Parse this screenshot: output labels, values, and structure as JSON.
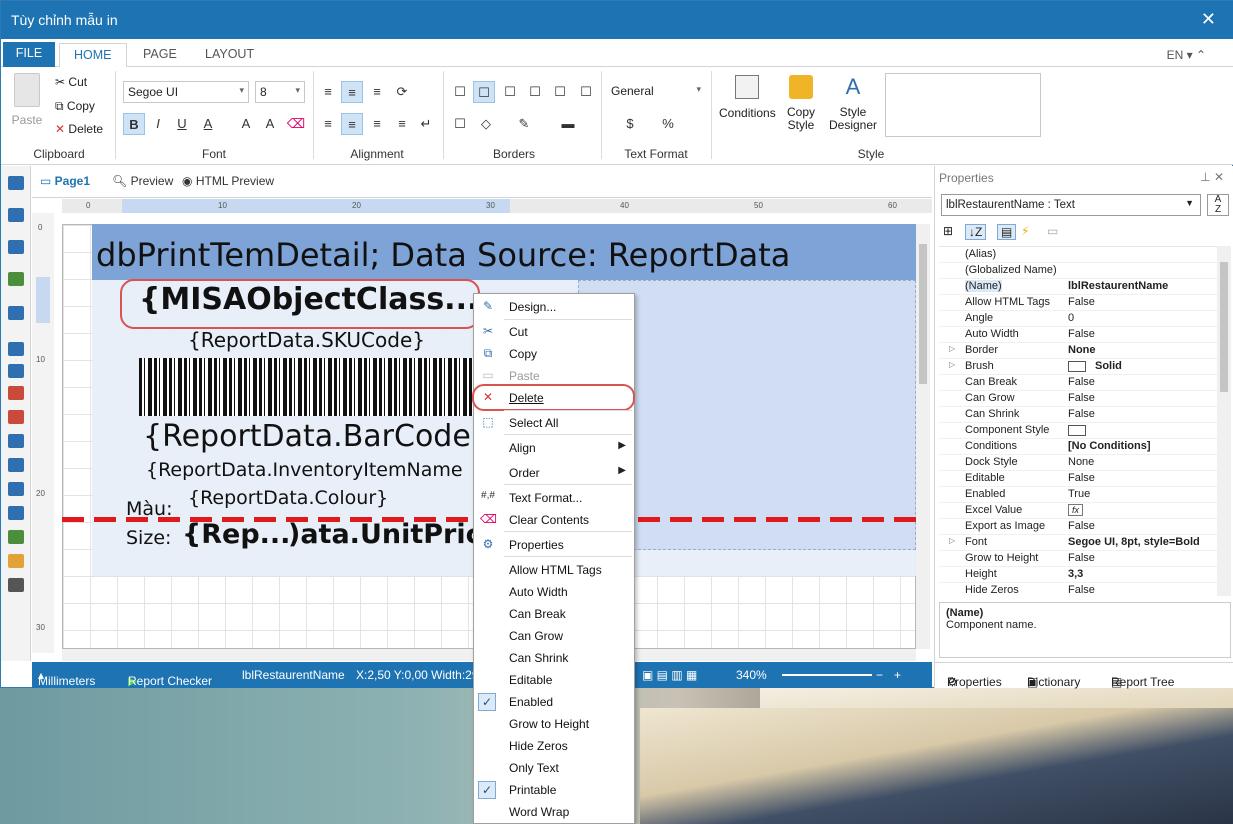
{
  "window": {
    "title": "Tùy chỉnh mẫu in",
    "close_icon": "close-icon"
  },
  "ribbon_tabs": {
    "file": "FILE",
    "home": "HOME",
    "page": "PAGE",
    "layout": "LAYOUT",
    "lang": "EN"
  },
  "clipboard": {
    "paste": "Paste",
    "cut": "Cut",
    "copy": "Copy",
    "delete": "Delete",
    "label": "Clipboard"
  },
  "font": {
    "family": "Segoe UI",
    "size": "8",
    "label": "Font"
  },
  "alignment": {
    "label": "Alignment"
  },
  "borders": {
    "label": "Borders"
  },
  "text_format": {
    "value": "General",
    "label": "Text Format"
  },
  "style": {
    "conditions": "Conditions",
    "copy_style": "Copy Style",
    "style_designer": "Style Designer",
    "label": "Style"
  },
  "designer_tabs": {
    "page1": "Page1",
    "preview": "Preview",
    "html_preview": "HTML Preview"
  },
  "ruler": {
    "h_ticks": [
      "0",
      "10",
      "20",
      "30",
      "40",
      "50",
      "60"
    ],
    "v_ticks": [
      "0",
      "10",
      "20",
      "30"
    ]
  },
  "report": {
    "title_band": "dbPrintTemDetail; Data Source: ReportData",
    "object_class": "{MISAObjectClass...",
    "sku": "{ReportData.SKUCode}",
    "barcode": "{ReportData.BarCode",
    "item_name": "{ReportData.InventoryItemName",
    "colour_label": "Màu:",
    "colour": "{ReportData.Colour}",
    "size_label": "Size:",
    "unit_price_a": "{Rep...",
    "unit_price_b": ")ata.UnitPric"
  },
  "status": {
    "units": "Millimeters",
    "checker": "Report Checker",
    "component": "lblRestaurentName",
    "coords": "X:2,50  Y:0,00  Width:29",
    "zoom": "340%"
  },
  "properties": {
    "header": "Properties",
    "selected": "lblRestaurentName : Text",
    "rows": [
      {
        "k": "(Alias)",
        "v": ""
      },
      {
        "k": "(Globalized Name)",
        "v": ""
      },
      {
        "k": "(Name)",
        "v": "lblRestaurentName"
      },
      {
        "k": "Allow HTML Tags",
        "v": "False"
      },
      {
        "k": "Angle",
        "v": "0"
      },
      {
        "k": "Auto Width",
        "v": "False"
      },
      {
        "k": "Border",
        "v": "None"
      },
      {
        "k": "Brush",
        "v": "Solid"
      },
      {
        "k": "Can Break",
        "v": "False"
      },
      {
        "k": "Can Grow",
        "v": "False"
      },
      {
        "k": "Can Shrink",
        "v": "False"
      },
      {
        "k": "Component Style",
        "v": ""
      },
      {
        "k": "Conditions",
        "v": "[No Conditions]"
      },
      {
        "k": "Dock Style",
        "v": "None"
      },
      {
        "k": "Editable",
        "v": "False"
      },
      {
        "k": "Enabled",
        "v": "True"
      },
      {
        "k": "Excel Value",
        "v": ""
      },
      {
        "k": "Export as Image",
        "v": "False"
      },
      {
        "k": "Font",
        "v": "Segoe UI, 8pt, style=Bold"
      },
      {
        "k": "Grow to Height",
        "v": "False"
      },
      {
        "k": "Height",
        "v": "3,3"
      },
      {
        "k": "Hide Zeros",
        "v": "False"
      }
    ],
    "desc_title": "(Name)",
    "desc_text": "Component name.",
    "tab_properties": "Properties",
    "tab_dictionary": "Dictionary",
    "tab_report_tree": "Report Tree"
  },
  "context_menu": {
    "design": "Design...",
    "cut": "Cut",
    "copy": "Copy",
    "paste": "Paste",
    "delete": "Delete",
    "select_all": "Select All",
    "align": "Align",
    "order": "Order",
    "text_format": "Text Format...",
    "clear_contents": "Clear Contents",
    "properties": "Properties",
    "allow_html_tags": "Allow HTML Tags",
    "auto_width": "Auto Width",
    "can_break": "Can Break",
    "can_grow": "Can Grow",
    "can_shrink": "Can Shrink",
    "editable": "Editable",
    "enabled": "Enabled",
    "grow_to_height": "Grow to Height",
    "hide_zeros": "Hide Zeros",
    "only_text": "Only Text",
    "printable": "Printable",
    "word_wrap": "Word Wrap"
  }
}
